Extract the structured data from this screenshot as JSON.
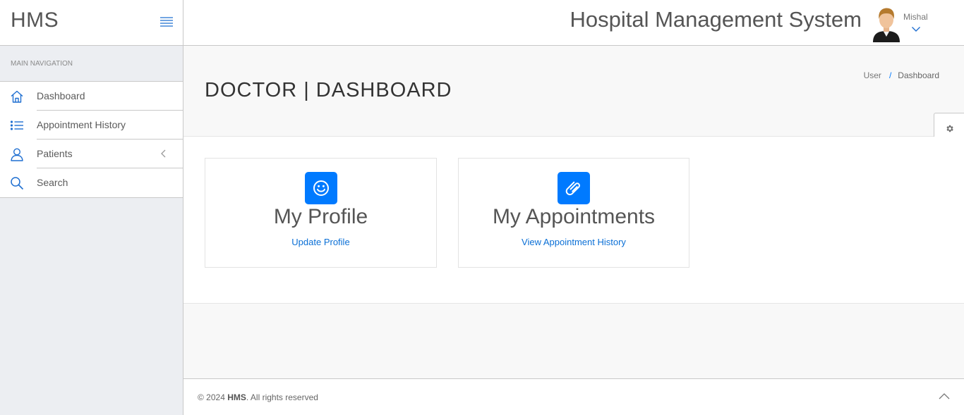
{
  "sidebar": {
    "brand": "HMS",
    "toggle_icon": "menu-lines-icon",
    "caption": "MAIN NAVIGATION",
    "items": [
      {
        "label": "Dashboard",
        "icon": "home-icon"
      },
      {
        "label": "Appointment History",
        "icon": "list-icon"
      },
      {
        "label": "Patients",
        "icon": "user-icon",
        "has_submenu": true
      },
      {
        "label": "Search",
        "icon": "search-icon"
      }
    ]
  },
  "header": {
    "title": "Hospital Management System",
    "user_name": "Mishal"
  },
  "page": {
    "title": "DOCTOR | DASHBOARD",
    "breadcrumb": {
      "parent": "User",
      "separator": "/",
      "current": "Dashboard"
    }
  },
  "cards": [
    {
      "icon": "smile-icon",
      "title": "My Profile",
      "link": "Update Profile"
    },
    {
      "icon": "paperclip-icon",
      "title": "My Appointments",
      "link": "View Appointment History"
    }
  ],
  "footer": {
    "copyright_prefix": "© 2024 ",
    "brand": "HMS",
    "copyright_suffix": ". All rights reserved"
  },
  "colors": {
    "accent": "#007aff",
    "link": "#0a6fd6",
    "sidebar_bg": "#eceef2"
  }
}
